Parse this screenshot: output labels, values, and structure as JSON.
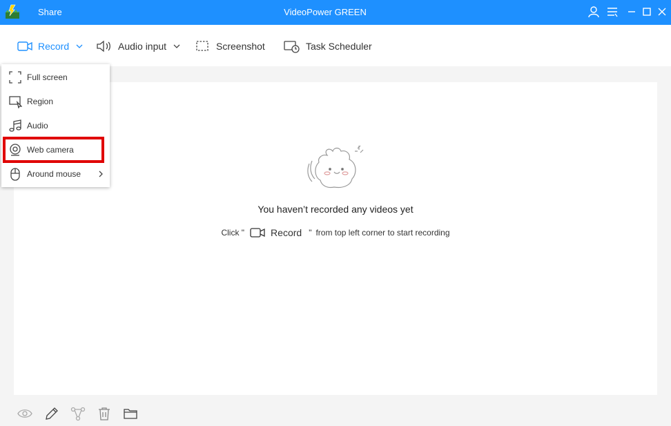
{
  "titlebar": {
    "share_label": "Share",
    "title": "VideoPower GREEN",
    "background_color": "#1e90ff",
    "icons": [
      "app-logo-icon",
      "user-icon",
      "menu-icon",
      "minimize-icon",
      "maximize-icon",
      "close-icon"
    ]
  },
  "toolbar": {
    "record_label": "Record",
    "audio_input_label": "Audio input",
    "screenshot_label": "Screenshot",
    "task_scheduler_label": "Task Scheduler",
    "accent_color": "#1e90ff"
  },
  "record_menu": {
    "items": [
      {
        "label": "Full screen",
        "icon": "full-screen-icon"
      },
      {
        "label": "Region",
        "icon": "region-icon"
      },
      {
        "label": "Audio",
        "icon": "music-note-icon"
      },
      {
        "label": "Web camera",
        "icon": "webcam-icon",
        "highlighted": true
      },
      {
        "label": "Around mouse",
        "icon": "mouse-icon",
        "has_submenu": true
      }
    ],
    "highlight_color": "#e00000"
  },
  "empty_state": {
    "title": "You haven’t recorded any videos yet",
    "hint_prefix": "Click \"",
    "hint_record": "Record",
    "hint_quote": "\"",
    "hint_suffix": "from top left corner to start recording"
  },
  "bottom_toolbar": {
    "icons": [
      "preview-eye-icon",
      "edit-pencil-icon",
      "share-nodes-icon",
      "delete-trash-icon",
      "open-folder-icon"
    ]
  }
}
